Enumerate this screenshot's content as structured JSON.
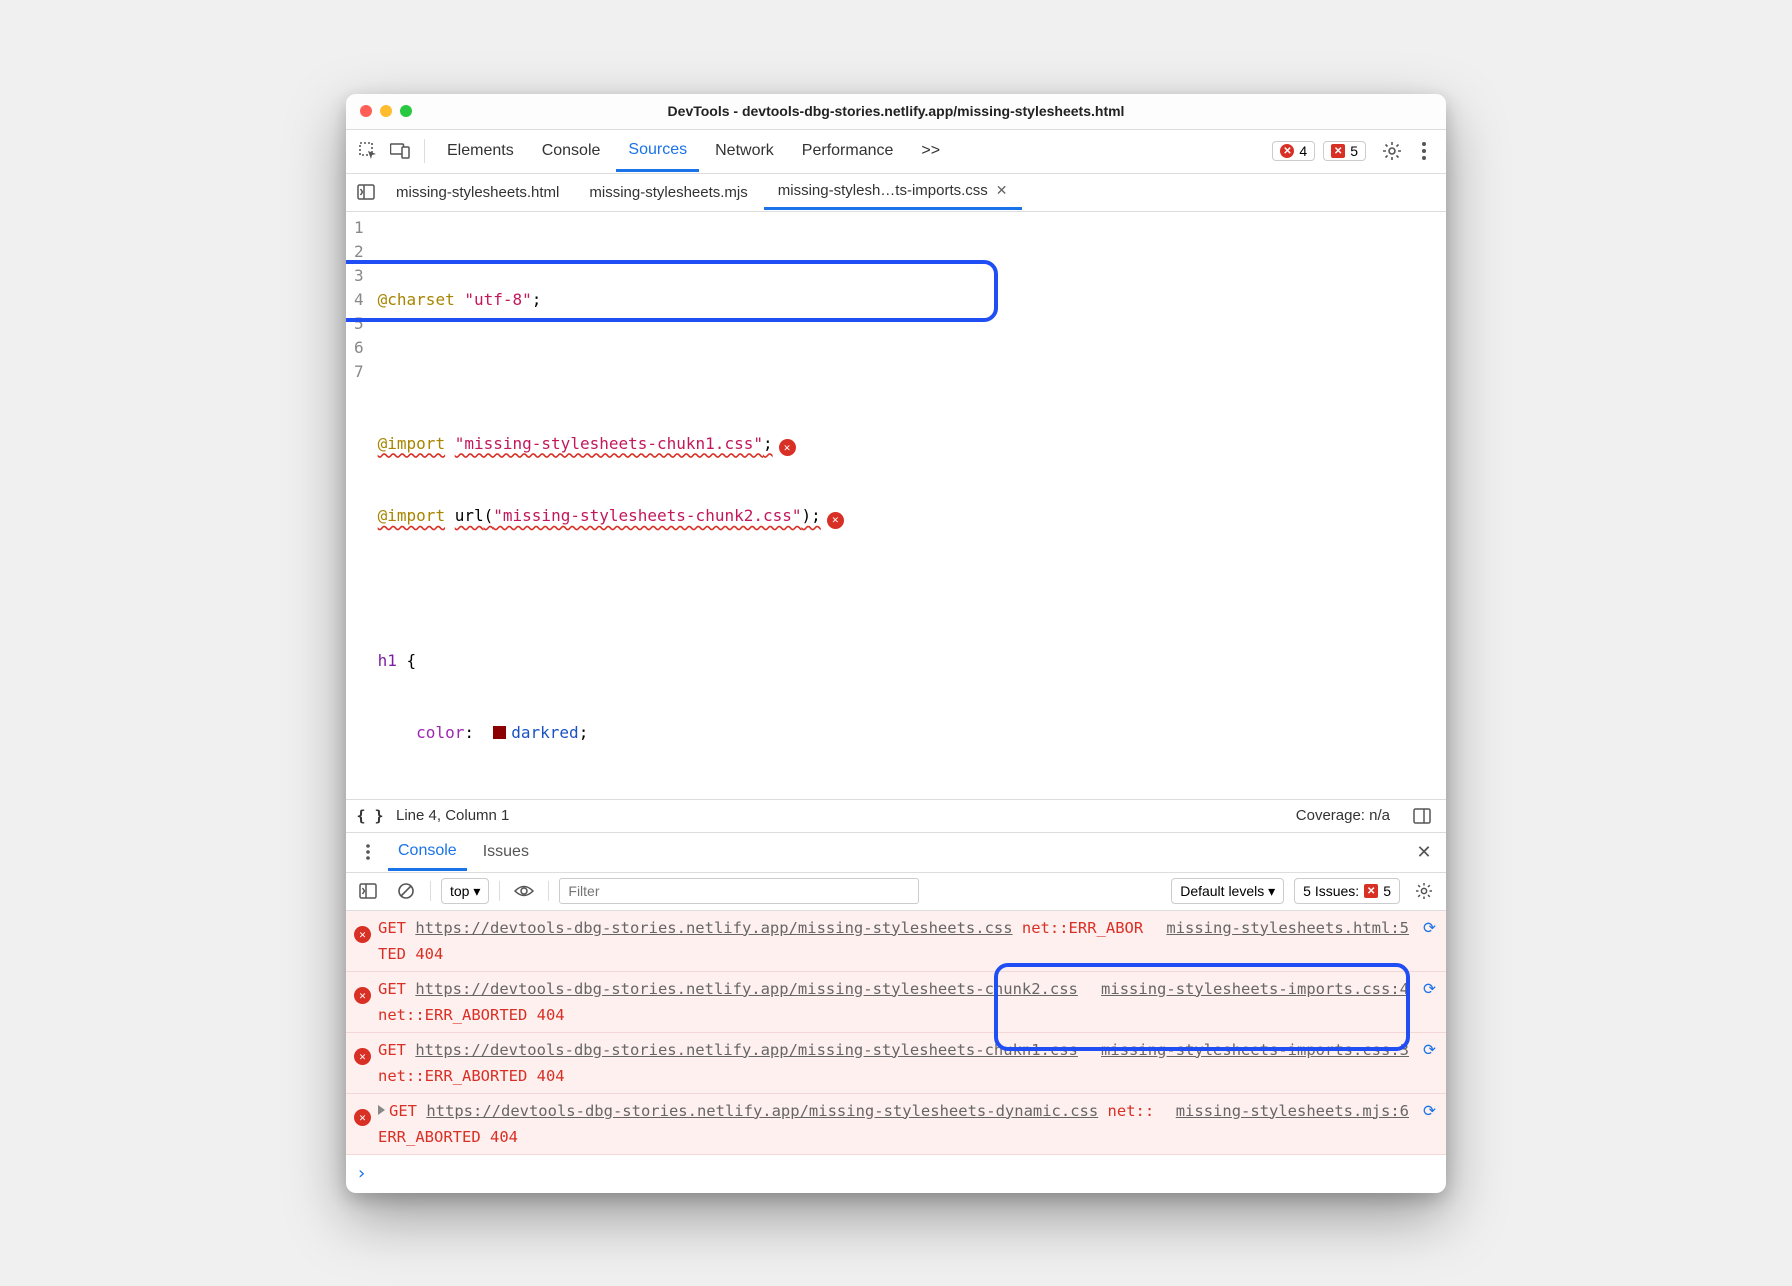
{
  "window": {
    "title": "DevTools - devtools-dbg-stories.netlify.app/missing-stylesheets.html"
  },
  "panels": {
    "elements": "Elements",
    "console": "Console",
    "sources": "Sources",
    "network": "Network",
    "performance": "Performance",
    "more": ">>"
  },
  "error_badge": {
    "count": "4"
  },
  "issues_badge": {
    "count": "5"
  },
  "files": {
    "t1": "missing-stylesheets.html",
    "t2": "missing-stylesheets.mjs",
    "t3": "missing-stylesh…ts-imports.css"
  },
  "code": {
    "l1_a": "@charset",
    "l1_b": "\"utf-8\"",
    "l1_c": ";",
    "l3_a": "@import",
    "l3_b": "\"missing-stylesheets-chukn1.css\"",
    "l3_c": ";",
    "l4_a": "@import",
    "l4_b": "url",
    "l4_c": "(",
    "l4_d": "\"missing-stylesheets-chunk2.css\"",
    "l4_e": ");",
    "l6_a": "h1",
    "l6_b": " {",
    "l7_a": "    ",
    "l7_b": "color",
    "l7_c": ":  ",
    "l7_d": "darkred",
    "l7_e": ";"
  },
  "gutter": {
    "n1": "1",
    "n2": "2",
    "n3": "3",
    "n4": "4",
    "n5": "5",
    "n6": "6",
    "n7": "7"
  },
  "status": {
    "pos": "Line 4, Column 1",
    "coverage": "Coverage: n/a"
  },
  "drawer": {
    "console": "Console",
    "issues": "Issues"
  },
  "ctoolbar": {
    "context": "top ▾",
    "filter_placeholder": "Filter",
    "levels": "Default levels ▾",
    "issues_label": "5 Issues:",
    "issues_count": "5"
  },
  "logs": [
    {
      "method": "GET ",
      "url": "https://devtools-dbg-stories.netlify.app/missing-stylesheets.css",
      "err": " net::ERR_ABORTED 404",
      "src": "missing-stylesheets.html:5"
    },
    {
      "method": "GET ",
      "url": "https://devtools-dbg-stories.netlify.app/missing-stylesheets-chunk2.css",
      "err": " net::ERR_ABORTED 404",
      "src": "missing-stylesheets-imports.css:4"
    },
    {
      "method": "GET ",
      "url": "https://devtools-dbg-stories.netlify.app/missing-stylesheets-chukn1.css",
      "err": " net::ERR_ABORTED 404",
      "src": "missing-stylesheets-imports.css:3"
    },
    {
      "method": "GET ",
      "url": "https://devtools-dbg-stories.netlify.app/missing-stylesheets-dynamic.css",
      "err": " net::ERR_ABORTED 404",
      "src": "missing-stylesheets.mjs:6",
      "expandable": true
    }
  ]
}
